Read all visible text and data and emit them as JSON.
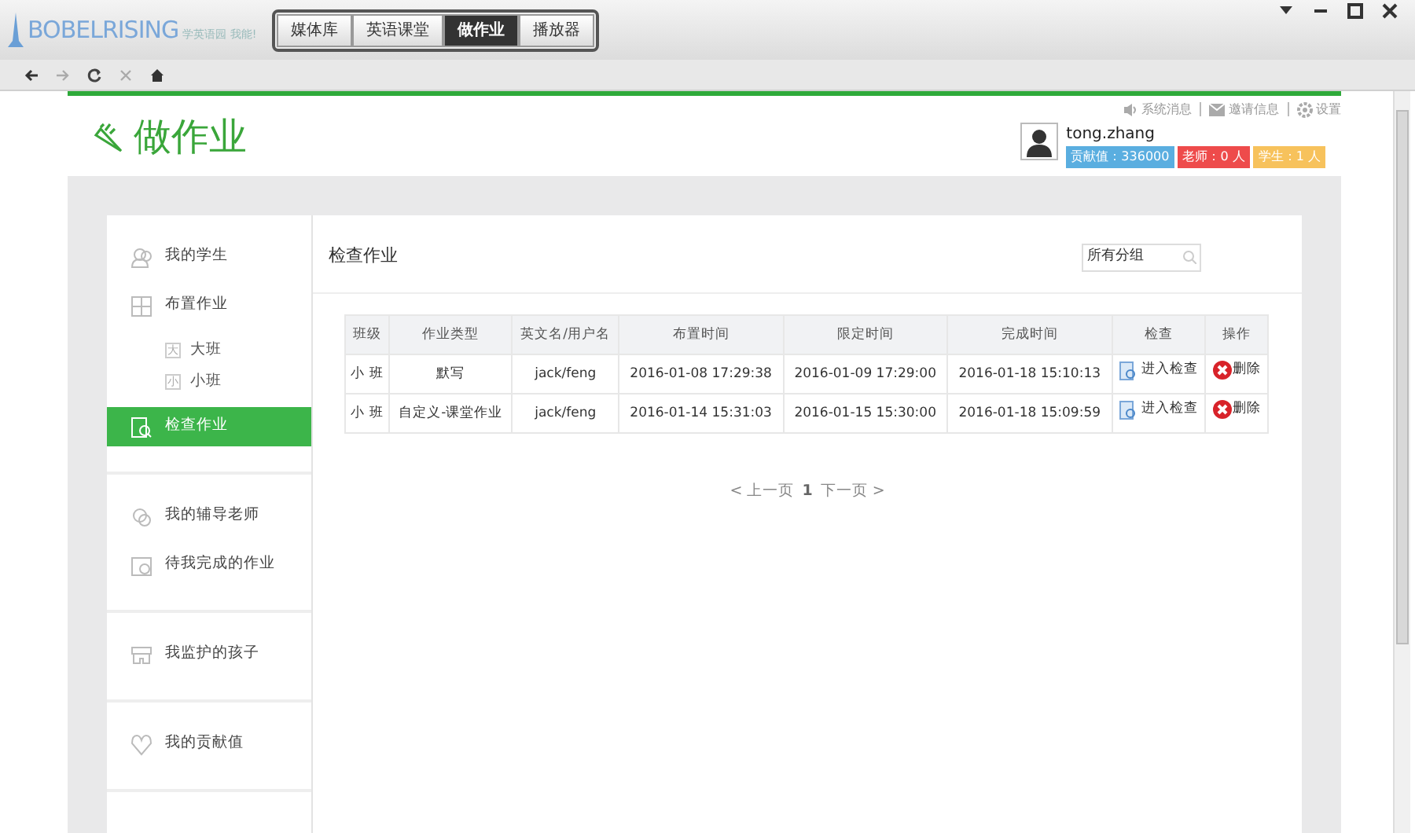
{
  "app": {
    "logo": "BOBELRISING",
    "tagline": "学英语园 我能!",
    "tabs": [
      {
        "label": "媒体库",
        "selected": false
      },
      {
        "label": "英语课堂",
        "selected": false
      },
      {
        "label": "做作业",
        "selected": true
      },
      {
        "label": "播放器",
        "selected": false
      }
    ]
  },
  "header": {
    "title": "做作业",
    "links": [
      "系统消息",
      "邀请信息",
      "设置"
    ],
    "user": {
      "name": "tong.zhang",
      "badges": [
        {
          "text": "贡献值：336000",
          "color": "#5aaee0"
        },
        {
          "text": "老师：0 人",
          "color": "#ee4b4b"
        },
        {
          "text": "学生：1 人",
          "color": "#f7c25c"
        }
      ]
    }
  },
  "sidebar": {
    "groups": [
      [
        {
          "label": "我的学生",
          "selected": false
        },
        {
          "label": "布置作业",
          "selected": false,
          "children": [
            {
              "icon_char": "大",
              "label": "大班"
            },
            {
              "icon_char": "小",
              "label": "小班"
            }
          ]
        },
        {
          "label": "检查作业",
          "selected": true
        }
      ],
      [
        {
          "label": "我的辅导老师",
          "selected": false
        },
        {
          "label": "待我完成的作业",
          "selected": false
        }
      ],
      [
        {
          "label": "我监护的孩子",
          "selected": false
        }
      ],
      [
        {
          "label": "我的贡献值",
          "selected": false
        }
      ]
    ]
  },
  "main": {
    "title": "检查作业",
    "group_filter": "所有分组",
    "table": {
      "columns": [
        "班级",
        "作业类型",
        "英文名/用户名",
        "布置时间",
        "限定时间",
        "完成时间",
        "检查",
        "操作"
      ],
      "rows": [
        {
          "cells": [
            "小 班",
            "默写",
            "jack/feng",
            "2016-01-08 17:29:38",
            "2016-01-09 17:29:00",
            "2016-01-18 15:10:13"
          ],
          "check": "进入检查",
          "action": "删除"
        },
        {
          "cells": [
            "小 班",
            "自定义-课堂作业",
            "jack/feng",
            "2016-01-14 15:31:03",
            "2016-01-15 15:30:00",
            "2016-01-18 15:09:59"
          ],
          "check": "进入检查",
          "action": "删除"
        }
      ]
    },
    "pagination": {
      "prev": "< 上一页",
      "page": "1",
      "next": "下一页 >"
    }
  }
}
